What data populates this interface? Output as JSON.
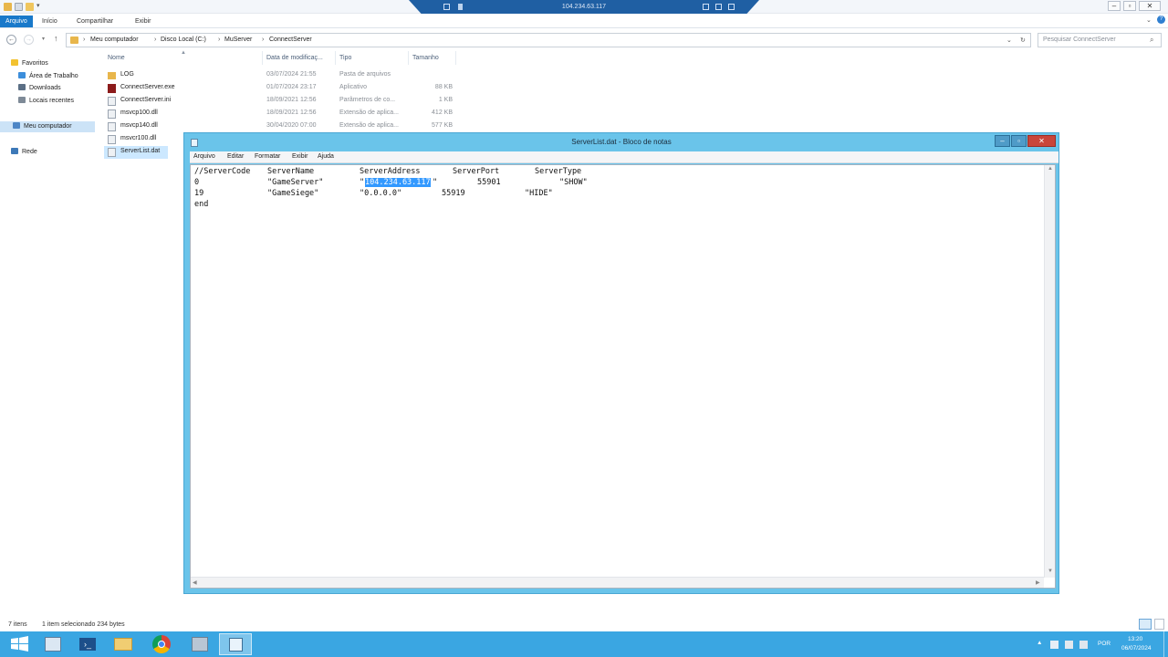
{
  "rdp": {
    "title": "104.234.63.117"
  },
  "ribbon": {
    "tabs": [
      "Arquivo",
      "Início",
      "Compartilhar",
      "Exibir"
    ]
  },
  "address": {
    "crumbs": [
      "Meu computador",
      "Disco Local (C:)",
      "MuServer",
      "ConnectServer"
    ],
    "search_placeholder": "Pesquisar ConnectServer"
  },
  "nav": {
    "favoritos": "Favoritos",
    "area_de_trabalho": "Área de Trabalho",
    "downloads": "Downloads",
    "locais_recentes": "Locais recentes",
    "meu_computador": "Meu computador",
    "rede": "Rede"
  },
  "columns": {
    "name": "Nome",
    "date": "Data de modificaç...",
    "type": "Tipo",
    "size": "Tamanho"
  },
  "files": [
    {
      "name": "LOG",
      "date": "03/07/2024 21:55",
      "type": "Pasta de arquivos",
      "size": ""
    },
    {
      "name": "ConnectServer.exe",
      "date": "01/07/2024 23:17",
      "type": "Aplicativo",
      "size": "88 KB"
    },
    {
      "name": "ConnectServer.ini",
      "date": "18/09/2021 12:56",
      "type": "Parâmetros de co...",
      "size": "1 KB"
    },
    {
      "name": "msvcp100.dll",
      "date": "18/09/2021 12:56",
      "type": "Extensão de aplica...",
      "size": "412 KB"
    },
    {
      "name": "msvcp140.dll",
      "date": "30/04/2020 07:00",
      "type": "Extensão de aplica...",
      "size": "577 KB"
    },
    {
      "name": "msvcr100.dll",
      "date": "",
      "type": "",
      "size": ""
    },
    {
      "name": "ServerList.dat",
      "date": "",
      "type": "",
      "size": ""
    }
  ],
  "status": {
    "count": "7 itens",
    "selection": "1 item selecionado  234 bytes"
  },
  "notepad": {
    "title": "ServerList.dat - Bloco de notas",
    "menu": [
      "Arquivo",
      "Editar",
      "Formatar",
      "Exibir",
      "Ajuda"
    ],
    "header": [
      "//ServerCode",
      "ServerName",
      "ServerAddress",
      "ServerPort",
      "ServerType"
    ],
    "row1": {
      "code": "0",
      "name": "\"GameServer\"",
      "addr_open": "\"",
      "addr_selected": "104.234.63.117",
      "addr_close": "\"",
      "port": "55901",
      "type": "\"SHOW\""
    },
    "row2": {
      "code": "19",
      "name": "\"GameSiege\"",
      "addr": "\"0.0.0.0\"",
      "port": "55919",
      "type": "\"HIDE\""
    },
    "end": "end"
  },
  "tray": {
    "lang": "POR",
    "time": "13:20",
    "date": "06/07/2024"
  }
}
